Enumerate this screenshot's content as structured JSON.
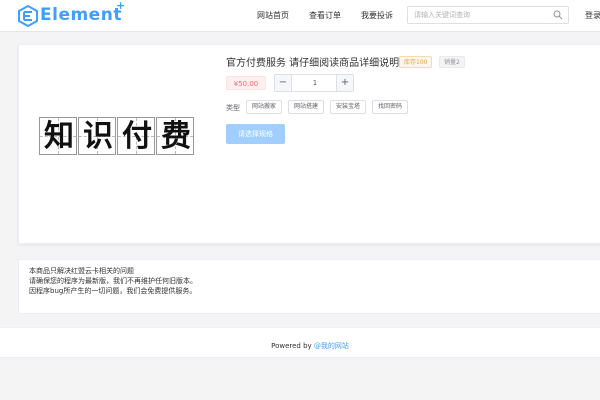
{
  "header": {
    "brand": "Element",
    "brand_sup": "+",
    "nav": [
      "网站首页",
      "查看订单",
      "我要投诉"
    ],
    "search_placeholder": "请输入关键词查询",
    "login": "登录"
  },
  "product": {
    "image_chars": [
      "知",
      "识",
      "付",
      "费"
    ],
    "title": "官方付费服务 请仔细阅读商品详细说明",
    "stock_tag": "库存100",
    "sales_tag": "销量2",
    "price": "¥50.00",
    "quantity": "1",
    "minus": "−",
    "plus": "+",
    "type_label": "类型",
    "types": [
      "网站搬家",
      "网站搭建",
      "安装宝塔",
      "找回密码"
    ],
    "submit": "请选择规格"
  },
  "notice": {
    "lines": [
      "本商品只解决红盟云卡相关的问题",
      "请确保您的程序为最新版，我们不再维护任何旧版本。",
      "因程序bug所产生的一切问题，我们会免费提供服务。"
    ]
  },
  "footer": {
    "powered": "Powered by ",
    "link": "@我的网站"
  },
  "colors": {
    "accent": "#409eff",
    "price": "#f56c6c",
    "stock": "#e6a23c"
  },
  "icons": {
    "logo": "element-logo-icon",
    "search": "search-icon"
  }
}
